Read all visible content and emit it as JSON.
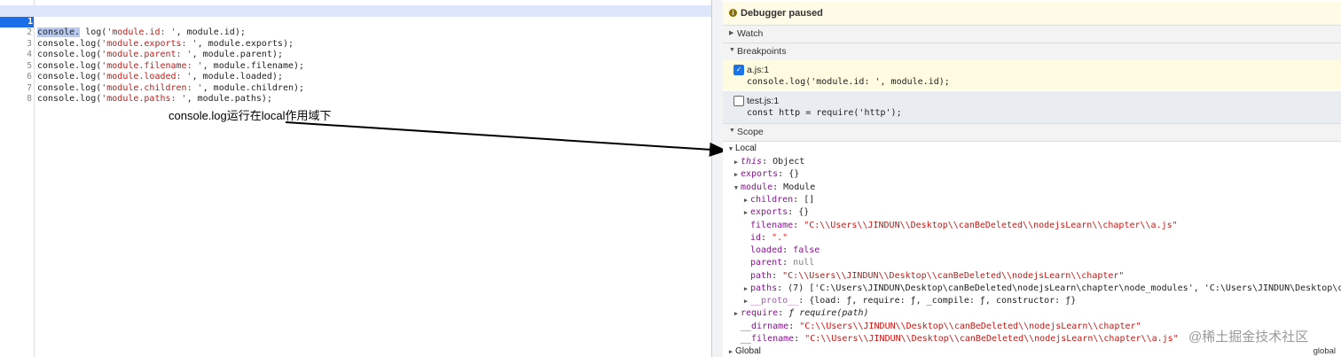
{
  "editor": {
    "lines": [
      {
        "n": "1",
        "pre": "console",
        "post": "log(",
        "str": "'module.id: '",
        "tail": ", module.id);"
      },
      {
        "n": "2",
        "pre": "console.log(",
        "post": "",
        "str": "'module.exports: '",
        "tail": ", module.exports);"
      },
      {
        "n": "3",
        "pre": "console.log(",
        "post": "",
        "str": "'module.parent: '",
        "tail": ", module.parent);"
      },
      {
        "n": "4",
        "pre": "console.log(",
        "post": "",
        "str": "'module.filename: '",
        "tail": ", module.filename);"
      },
      {
        "n": "5",
        "pre": "console.log(",
        "post": "",
        "str": "'module.loaded: '",
        "tail": ", module.loaded);"
      },
      {
        "n": "6",
        "pre": "console.log(",
        "post": "",
        "str": "'module.children: '",
        "tail": ", module.children);"
      },
      {
        "n": "7",
        "pre": "console.log(",
        "post": "",
        "str": "'module.paths: '",
        "tail": ", module.paths);"
      },
      {
        "n": "8",
        "pre": "",
        "post": "",
        "str": "",
        "tail": ""
      }
    ]
  },
  "annotation": "console.log运行在local作用域下",
  "debugger": {
    "status": "Debugger paused",
    "sections": {
      "watch": "Watch",
      "breakpoints": "Breakpoints",
      "scope": "Scope"
    },
    "breakpoints": [
      {
        "file": "a.js:1",
        "code": "console.log('module.id: ', module.id);",
        "checked": true
      },
      {
        "file": "test.js:1",
        "code": "const http = require('http');",
        "checked": false
      }
    ],
    "scope": {
      "local_label": "Local",
      "this_key": "this",
      "this_val": "Object",
      "exports_key": "exports",
      "exports_val": "{}",
      "module_key": "module",
      "module_val": "Module",
      "children_key": "children",
      "children_val": "[]",
      "mexports_key": "exports",
      "mexports_val": "{}",
      "filename_key": "filename",
      "filename_val": "\"C:\\\\Users\\\\JINDUN\\\\Desktop\\\\canBeDeleted\\\\nodejsLearn\\\\chapter\\\\a.js\"",
      "id_key": "id",
      "id_val": "\".\"",
      "loaded_key": "loaded",
      "loaded_val": "false",
      "parent_key": "parent",
      "parent_val": "null",
      "path_key": "path",
      "path_val": "\"C:\\\\Users\\\\JINDUN\\\\Desktop\\\\canBeDeleted\\\\nodejsLearn\\\\chapter\"",
      "paths_key": "paths",
      "paths_val": "(7) ['C:\\Users\\JINDUN\\Desktop\\canBeDeleted\\nodejsLearn\\chapter\\node_modules', 'C:\\Users\\JINDUN\\Desktop\\ca…",
      "proto_key": "__proto__",
      "proto_val": "{load: ƒ, require: ƒ, _compile: ƒ, constructor: ƒ}",
      "require_key": "require",
      "require_val": "ƒ require(path)",
      "dirname_key": "__dirname",
      "dirname_val": "\"C:\\\\Users\\\\JINDUN\\\\Desktop\\\\canBeDeleted\\\\nodejsLearn\\\\chapter\"",
      "filename2_key": "__filename",
      "filename2_val": "\"C:\\\\Users\\\\JINDUN\\\\Desktop\\\\canBeDeleted\\\\nodejsLearn\\\\chapter\\\\a.js\"",
      "global_label": "Global",
      "global_right": "global"
    }
  },
  "watermark": "@稀土掘金技术社区",
  "colors": {
    "accent": "#1a73e8",
    "string": "#c41a16",
    "key": "#881391"
  }
}
